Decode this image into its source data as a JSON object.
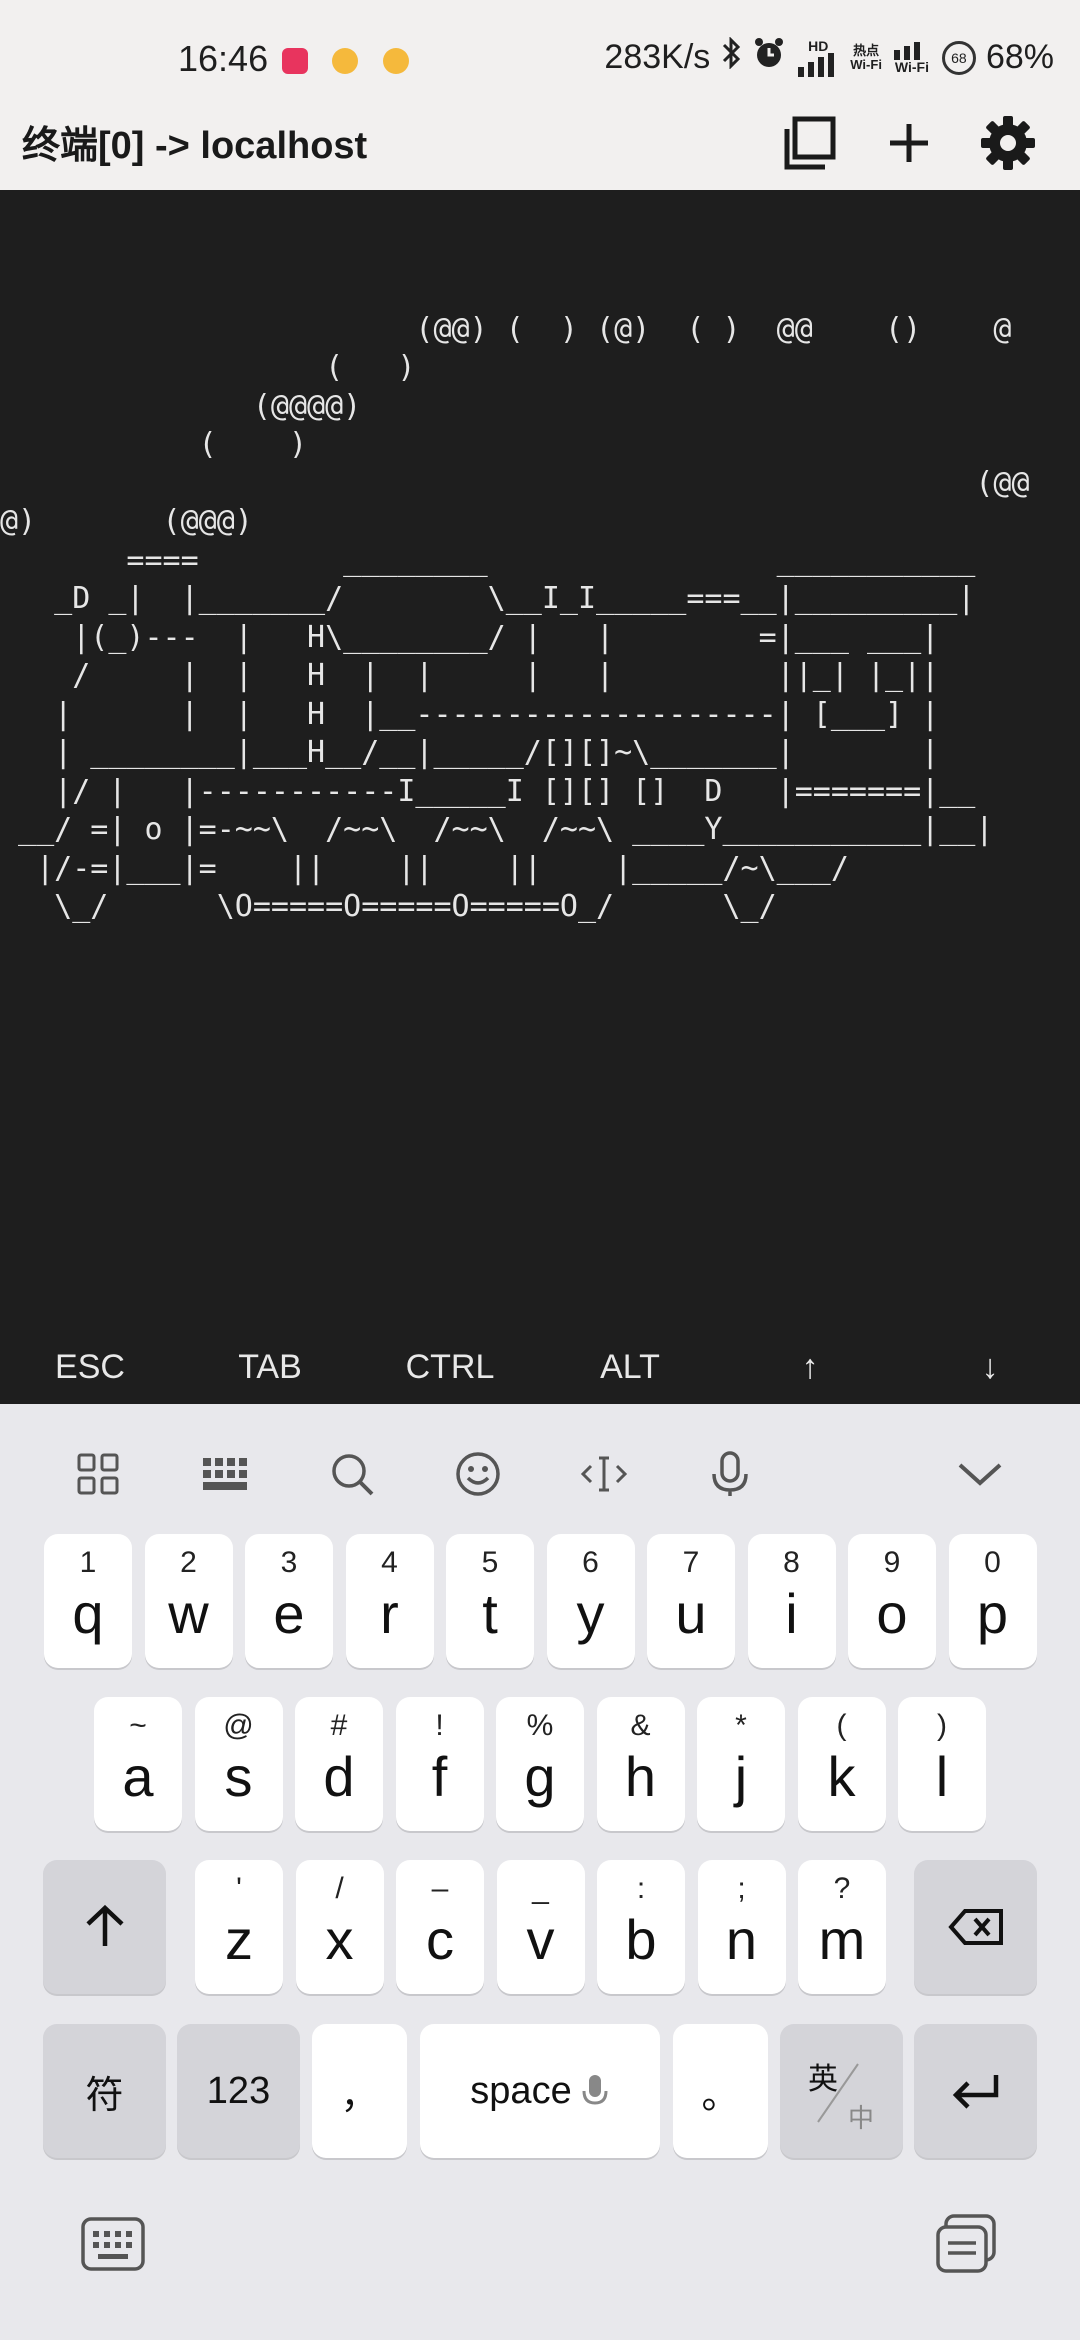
{
  "status_bar": {
    "time": "16:46",
    "net_speed": "283K/s",
    "hd_label": "HD",
    "hotspot_label": "热点\nWi-Fi",
    "wifi_label": "Wi-Fi",
    "battery_level": "68",
    "battery_pct": "68%"
  },
  "header": {
    "title": "终端[0] -> localhost"
  },
  "terminal": {
    "lines": [
      "",
      "",
      "",
      "                       (@@) (  ) (@)  ( )  @@    ()    @",
      "                  (   )",
      "              (@@@@)",
      "           (    )",
      "                                                      (@@",
      "@)       (@@@)",
      "       ====        ________                ___________",
      "   _D _|  |_______/        \\__I_I_____===__|_________|",
      "    |(_)---  |   H\\________/ |   |        =|___ ___|",
      "    /     |  |   H  |  |     |   |         ||_| |_||",
      "   |      |  |   H  |__--------------------| [___] |",
      "   | ________|___H__/__|_____/[][]~\\_______|       |",
      "   |/ |   |-----------I_____I [][] []  D   |=======|__",
      " __/ =| o |=-~~\\  /~~\\  /~~\\  /~~\\ ____Y___________|__|",
      "  |/-=|___|=    ||    ||    ||    |_____/~\\___/",
      "   \\_/      \\O=====O=====O=====O_/      \\_/"
    ]
  },
  "extra_keys": [
    "ESC",
    "TAB",
    "CTRL",
    "ALT",
    "↑",
    "↓"
  ],
  "keyboard": {
    "row1": [
      {
        "hint": "1",
        "key": "q"
      },
      {
        "hint": "2",
        "key": "w"
      },
      {
        "hint": "3",
        "key": "e"
      },
      {
        "hint": "4",
        "key": "r"
      },
      {
        "hint": "5",
        "key": "t"
      },
      {
        "hint": "6",
        "key": "y"
      },
      {
        "hint": "7",
        "key": "u"
      },
      {
        "hint": "8",
        "key": "i"
      },
      {
        "hint": "9",
        "key": "o"
      },
      {
        "hint": "0",
        "key": "p"
      }
    ],
    "row2": [
      {
        "hint": "~",
        "key": "a"
      },
      {
        "hint": "@",
        "key": "s"
      },
      {
        "hint": "#",
        "key": "d"
      },
      {
        "hint": "!",
        "key": "f"
      },
      {
        "hint": "%",
        "key": "g"
      },
      {
        "hint": "&",
        "key": "h"
      },
      {
        "hint": "*",
        "key": "j"
      },
      {
        "hint": "(",
        "key": "k"
      },
      {
        "hint": ")",
        "key": "l"
      }
    ],
    "row3": [
      {
        "hint": "'",
        "key": "z"
      },
      {
        "hint": "/",
        "key": "x"
      },
      {
        "hint": "–",
        "key": "c"
      },
      {
        "hint": "_",
        "key": "v"
      },
      {
        "hint": ":",
        "key": "b"
      },
      {
        "hint": ";",
        "key": "n"
      },
      {
        "hint": "?",
        "key": "m"
      }
    ],
    "symbols_label": "符",
    "numbers_label": "123",
    "comma_label": "，",
    "space_label": "space",
    "period_label": "。",
    "lang_en": "英",
    "lang_zh": "中"
  }
}
